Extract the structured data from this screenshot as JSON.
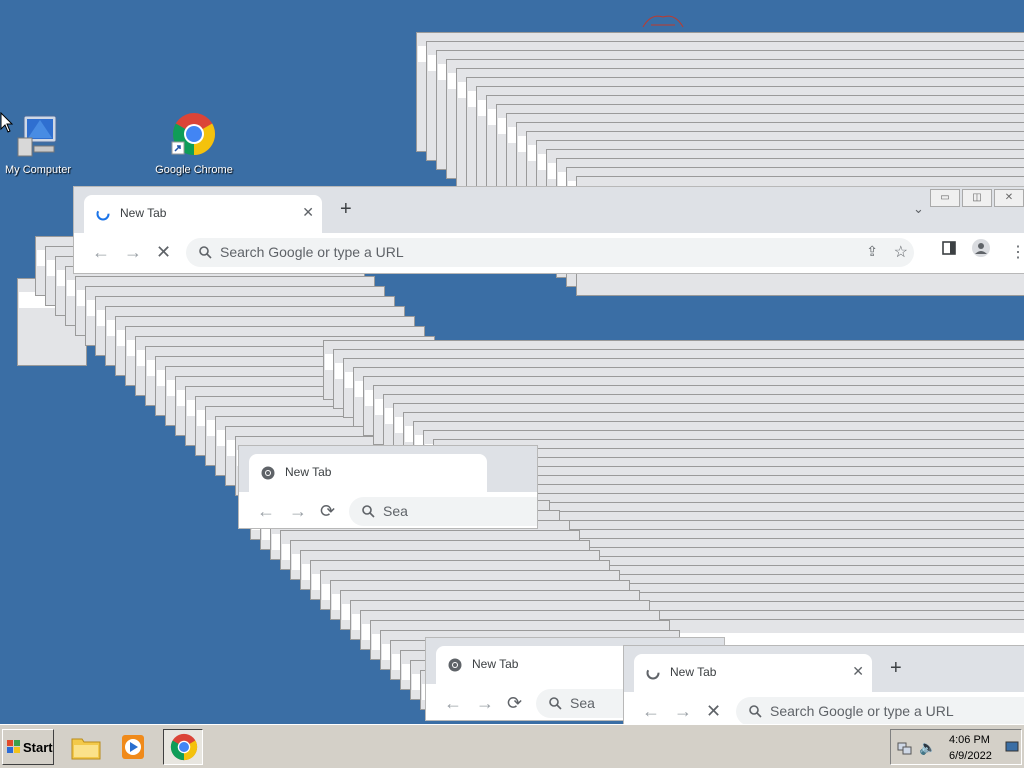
{
  "desktop": {
    "icons": [
      {
        "label": "My Computer",
        "icon": "computer-icon"
      },
      {
        "label": "Google Chrome",
        "icon": "chrome-icon"
      }
    ]
  },
  "main_window": {
    "tab_title": "New Tab",
    "omnibox_placeholder": "Search Google or type a URL",
    "controls": {
      "minimize": "▭",
      "restore": "◫",
      "close": "✕"
    }
  },
  "window_b": {
    "tab_title": "New Tab",
    "omnibox_placeholder": "Sea"
  },
  "window_c": {
    "tab_title": "New Tab",
    "omnibox_placeholder": "Sea"
  },
  "window_d": {
    "tab_title": "New Tab",
    "omnibox_placeholder": "Search Google or type a URL"
  },
  "taskbar": {
    "start_label": "Start",
    "clock_time": "4:06 PM",
    "clock_date": "6/9/2022"
  },
  "colors": {
    "desktop": "#3a6ea5",
    "taskbar": "#d4d0c8"
  }
}
